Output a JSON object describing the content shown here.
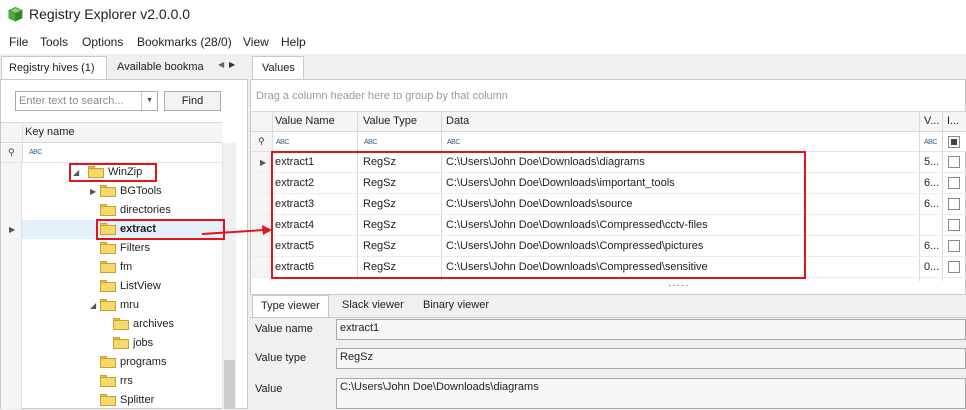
{
  "app": {
    "title": "Registry Explorer v2.0.0.0"
  },
  "menu": [
    "File",
    "Tools",
    "Options",
    "Bookmarks (28/0)",
    "View",
    "Help"
  ],
  "left_tabs": {
    "hives": "Registry hives (1)",
    "available": "Available bookma"
  },
  "search": {
    "placeholder": "Enter text to search...",
    "find_label": "Find"
  },
  "tree": {
    "header": "Key name",
    "items": [
      {
        "label": "WinZip",
        "expanded": true
      },
      {
        "label": "BGTools",
        "expandable": true
      },
      {
        "label": "directories"
      },
      {
        "label": "extract",
        "selected": true
      },
      {
        "label": "Filters"
      },
      {
        "label": "fm"
      },
      {
        "label": "ListView"
      },
      {
        "label": "mru",
        "expanded": true
      },
      {
        "label": "archives"
      },
      {
        "label": "jobs"
      },
      {
        "label": "programs"
      },
      {
        "label": "rrs"
      },
      {
        "label": "Splitter"
      }
    ]
  },
  "values_tab": "Values",
  "group_hint": "Drag a column header here to group by that column",
  "grid": {
    "columns": [
      "Value Name",
      "Value Type",
      "Data",
      "V...",
      "I..."
    ],
    "rows": [
      {
        "name": "extract1",
        "type": "RegSz",
        "data": "C:\\Users\\John Doe\\Downloads\\diagrams",
        "v": "5...",
        "current": true
      },
      {
        "name": "extract2",
        "type": "RegSz",
        "data": "C:\\Users\\John Doe\\Downloads\\important_tools",
        "v": "6..."
      },
      {
        "name": "extract3",
        "type": "RegSz",
        "data": "C:\\Users\\John Doe\\Downloads\\source",
        "v": "6..."
      },
      {
        "name": "extract4",
        "type": "RegSz",
        "data": "C:\\Users\\John Doe\\Downloads\\Compressed\\cctv-files",
        "v": ""
      },
      {
        "name": "extract5",
        "type": "RegSz",
        "data": "C:\\Users\\John Doe\\Downloads\\Compressed\\pictures",
        "v": "6..."
      },
      {
        "name": "extract6",
        "type": "RegSz",
        "data": "C:\\Users\\John Doe\\Downloads\\Compressed\\sensitive",
        "v": "0..."
      }
    ]
  },
  "viewer": {
    "tabs": [
      "Type viewer",
      "Slack viewer",
      "Binary viewer"
    ],
    "value_name_label": "Value name",
    "value_name": "extract1",
    "value_type_label": "Value type",
    "value_type": "RegSz",
    "value_label": "Value",
    "value": "C:\\Users\\John Doe\\Downloads\\diagrams"
  },
  "annotation_color": "#e0161b",
  "folder_color": "#f6d96a"
}
